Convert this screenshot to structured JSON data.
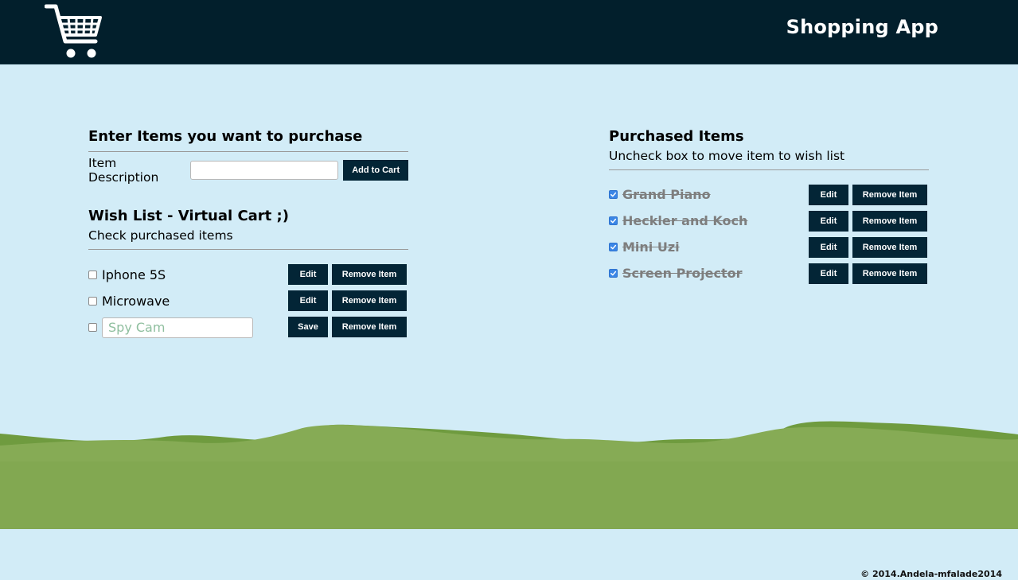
{
  "header": {
    "logo_icon": "shopping-cart-icon",
    "title": "Shopping App"
  },
  "entry": {
    "heading": "Enter Items you want to purchase",
    "label": "Item Description",
    "input_value": "",
    "add_button": "Add to Cart"
  },
  "wishlist": {
    "heading": "Wish List - Virtual Cart ;)",
    "subheading": "Check purchased items",
    "items": [
      {
        "label": "Iphone 5S",
        "checked": false,
        "edit_button": "Edit",
        "remove_button": "Remove Item"
      },
      {
        "label": "Microwave",
        "checked": false,
        "edit_button": "Edit",
        "remove_button": "Remove Item"
      },
      {
        "label": "Spy Cam",
        "checked": false,
        "editing": true,
        "save_button": "Save",
        "remove_button": "Remove Item"
      }
    ]
  },
  "purchased": {
    "heading": "Purchased Items",
    "subheading": "Uncheck box to move item to wish list",
    "items": [
      {
        "label": "Grand Piano",
        "checked": true,
        "edit_button": "Edit",
        "remove_button": "Remove Item"
      },
      {
        "label": "Heckler and Koch",
        "checked": true,
        "edit_button": "Edit",
        "remove_button": "Remove Item"
      },
      {
        "label": "Mini Uzi",
        "checked": true,
        "edit_button": "Edit",
        "remove_button": "Remove Item"
      },
      {
        "label": "Screen Projector",
        "checked": true,
        "edit_button": "Edit",
        "remove_button": "Remove Item"
      }
    ]
  },
  "footer": {
    "copyright": "© 2014.Andela-mfalade2014"
  },
  "colors": {
    "header_bg": "#021f2c",
    "button_bg": "#032536",
    "page_bg": "#d2ecf7",
    "grass": "#7fa54e",
    "checkbox_checked": "#3b86e6"
  }
}
